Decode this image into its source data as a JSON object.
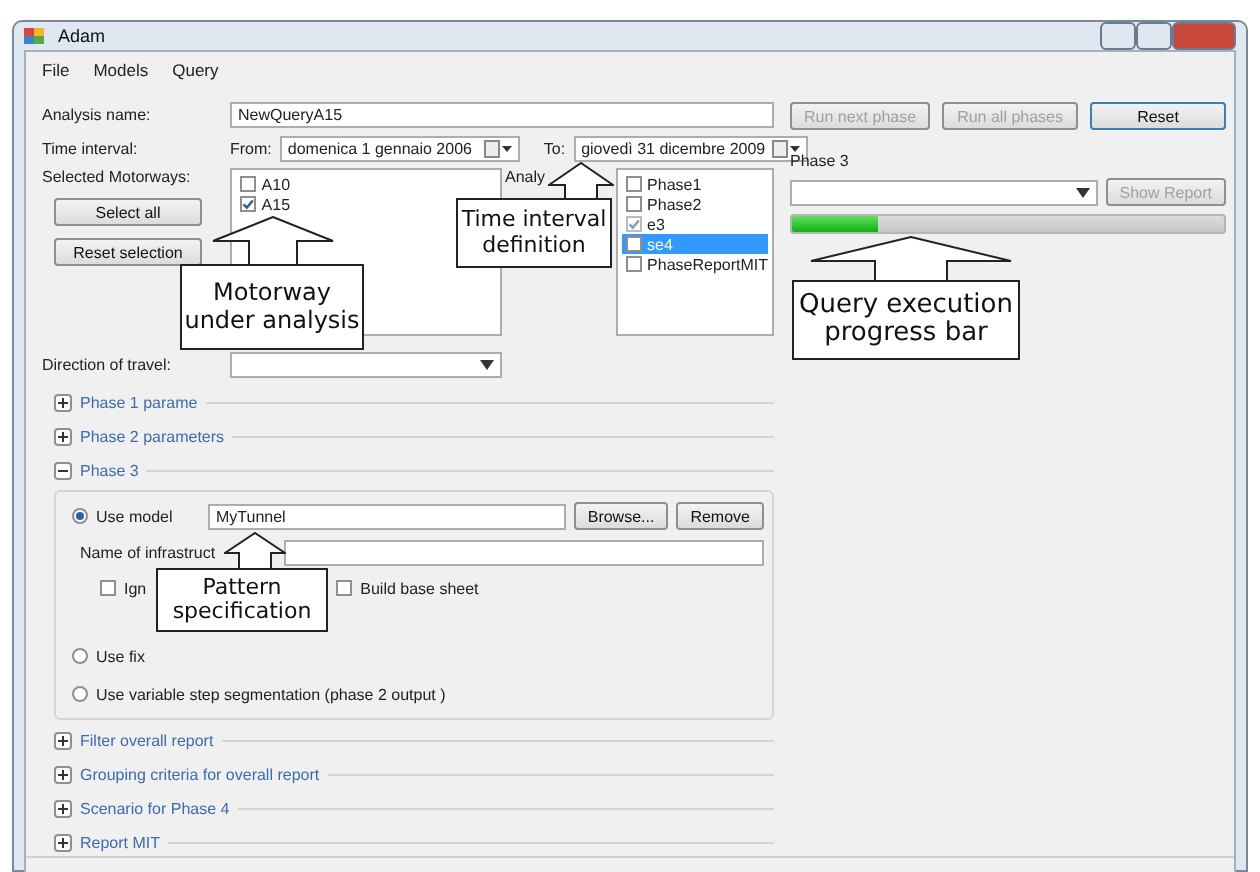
{
  "window": {
    "title": "Adam"
  },
  "menu": [
    "File",
    "Models",
    "Query"
  ],
  "analysis_name": {
    "label": "Analysis name:",
    "value": "NewQueryA15"
  },
  "time_interval": {
    "label": "Time interval:",
    "from_label": "From:",
    "from": "domenica 1 gennaio 2006",
    "to_label": "To:",
    "to": "giovedì 31 dicembre 2009"
  },
  "motorways": {
    "label": "Selected Motorways:",
    "items": [
      {
        "label": "A10",
        "checked": false
      },
      {
        "label": "A15",
        "checked": true
      }
    ],
    "buttons": [
      "Select all",
      "Reset selection"
    ]
  },
  "phases": {
    "label": "Analy",
    "items": [
      {
        "label": "Phase1",
        "checked": false,
        "selected": false
      },
      {
        "label": "Phase2",
        "checked": false,
        "selected": false
      },
      {
        "label": "e3",
        "checked": true,
        "selected": false
      },
      {
        "label": "se4",
        "checked": false,
        "selected": true
      },
      {
        "label": "PhaseReportMIT",
        "checked": false,
        "selected": false
      }
    ]
  },
  "direction": {
    "label": "Direction of travel:"
  },
  "sections": [
    {
      "title": "Phase 1 parame",
      "expanded": false
    },
    {
      "title": "Phase 2 parameters",
      "expanded": false
    },
    {
      "title": "Phase 3",
      "expanded": true,
      "options": [
        {
          "kind": "model",
          "label": "Use model",
          "selected": true,
          "model": "MyTunnel",
          "buttons": [
            "Browse...",
            "Remove"
          ],
          "infrastructure_label": "Name of infrastruct",
          "checkboxes": [
            {
              "label": "Ign",
              "checked": false
            },
            {
              "label": "Build base sheet",
              "checked": false
            }
          ]
        },
        {
          "kind": "plain",
          "label": "Use fix",
          "selected": false
        },
        {
          "kind": "plain",
          "label": "Use variable step segmentation (phase 2 output )",
          "selected": false
        }
      ]
    },
    {
      "title": "Filter overall report",
      "expanded": false
    },
    {
      "title": "Grouping criteria for overall report",
      "expanded": false
    },
    {
      "title": "Scenario for Phase 4",
      "expanded": false
    },
    {
      "title": "Report MIT",
      "expanded": false
    }
  ],
  "right": {
    "buttons": [
      {
        "label": "Run next phase",
        "disabled": true
      },
      {
        "label": "Run all phases",
        "disabled": true
      },
      {
        "label": "Reset",
        "disabled": false
      }
    ],
    "phase_label": "Phase 3",
    "show_report": {
      "label": "Show Report",
      "disabled": true
    },
    "progress": {
      "level": 0.2
    }
  },
  "callouts": [
    {
      "text": "Motorway under analysis"
    },
    {
      "text": "Time interval definition"
    },
    {
      "text": "Query execution progress bar"
    },
    {
      "text": "Pattern specification"
    }
  ]
}
